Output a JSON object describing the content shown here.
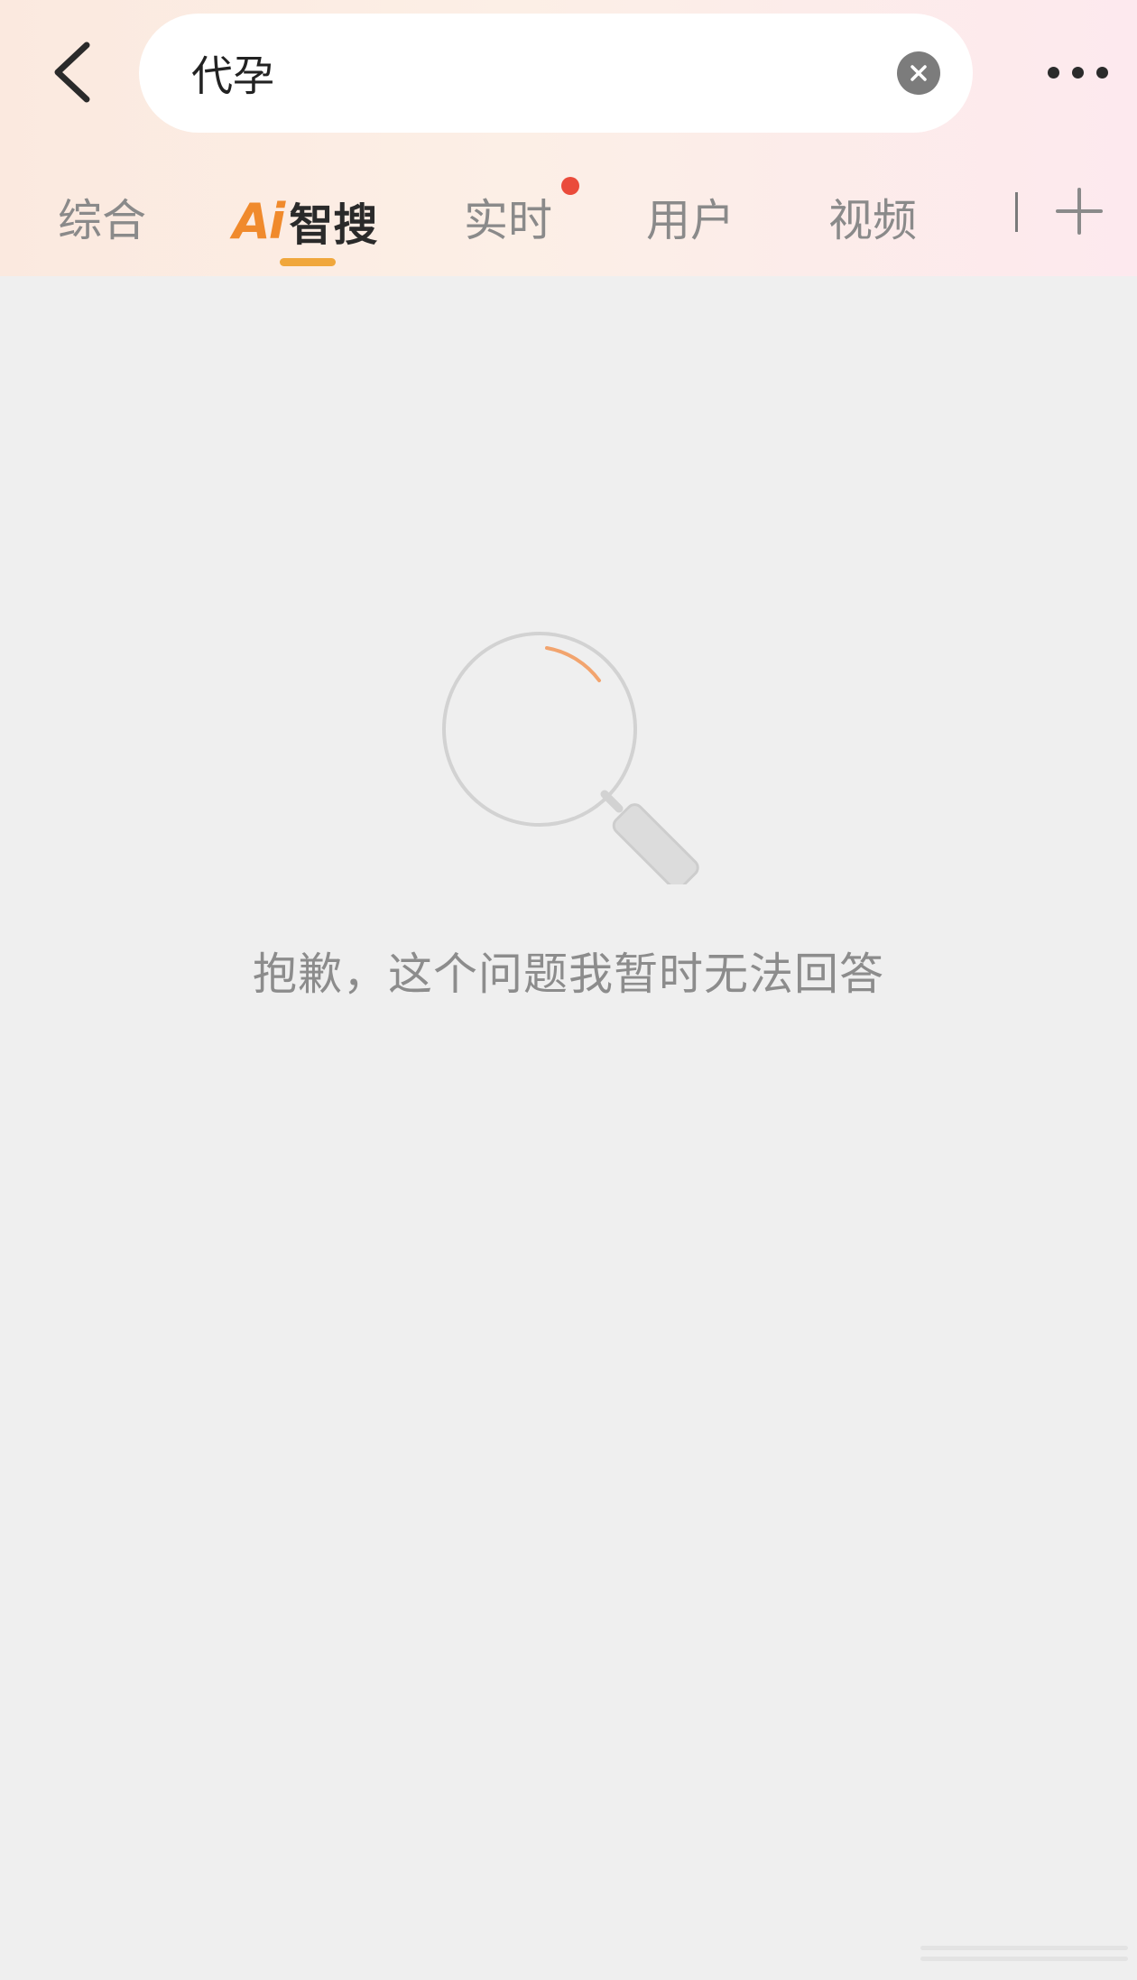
{
  "search": {
    "query": "代孕"
  },
  "tabs": {
    "items": [
      {
        "label": "综合"
      },
      {
        "logo": "Ai",
        "label": "智搜"
      },
      {
        "label": "实时"
      },
      {
        "label": "用户"
      },
      {
        "label": "视频"
      }
    ]
  },
  "empty_state": {
    "message": "抱歉，这个问题我暂时无法回答"
  },
  "colors": {
    "accent": "#f0a73c",
    "badge": "#ea4b3b",
    "ai_logo": "#f08a2c"
  },
  "icons": [
    "back-arrow-icon",
    "clear-icon",
    "more-dots-icon",
    "add-icon",
    "magnifier-icon"
  ]
}
